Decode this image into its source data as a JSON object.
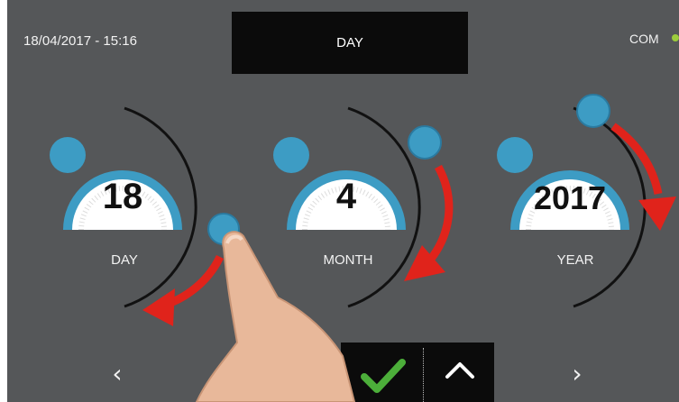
{
  "header": {
    "datetime": "18/04/2017 - 15:16",
    "title": "DAY",
    "com_label": "COM",
    "com_status_color": "#9ccc3c"
  },
  "dials": [
    {
      "label": "DAY",
      "value": "18"
    },
    {
      "label": "MONTH",
      "value": "4"
    },
    {
      "label": "YEAR",
      "value": "2017"
    }
  ],
  "nav": {
    "prev_symbol": "‹",
    "next_symbol": "›"
  },
  "icons": {
    "confirm": "check-icon",
    "up": "chevron-up-icon",
    "prev": "chevron-left-icon",
    "next": "chevron-right-icon"
  },
  "colors": {
    "background": "#555759",
    "accent_blue": "#3d9cc4",
    "arrow_red": "#e0231b",
    "confirm_green": "#4cae3a"
  }
}
